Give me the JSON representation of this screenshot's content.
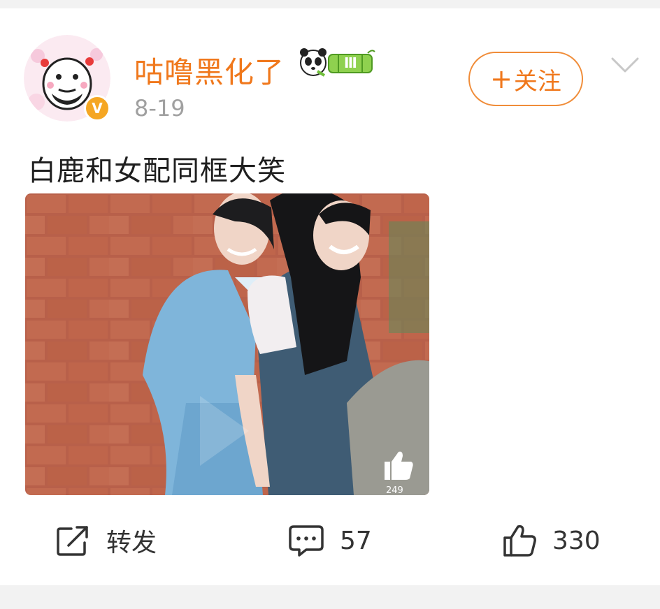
{
  "post": {
    "author": {
      "name": "咕噜黑化了",
      "badge_level": "Ⅲ",
      "verified_mark": "V"
    },
    "time": "8-19",
    "follow_label": "关注",
    "text": "白鹿和女配同框大笑",
    "media": {
      "type": "video",
      "overlay_like_count": "249"
    },
    "actions": {
      "repost_label": "转发",
      "comment_count": "57",
      "like_count": "330"
    }
  },
  "colors": {
    "accent": "#f0781c",
    "follow_border": "#f08c38",
    "verified": "#f5a623",
    "muted_text": "#a0a0a0"
  },
  "icons": [
    "more-chevron-icon",
    "repost-icon",
    "comment-icon",
    "like-icon",
    "thumbs-up-icon",
    "panda-badge-icon"
  ]
}
